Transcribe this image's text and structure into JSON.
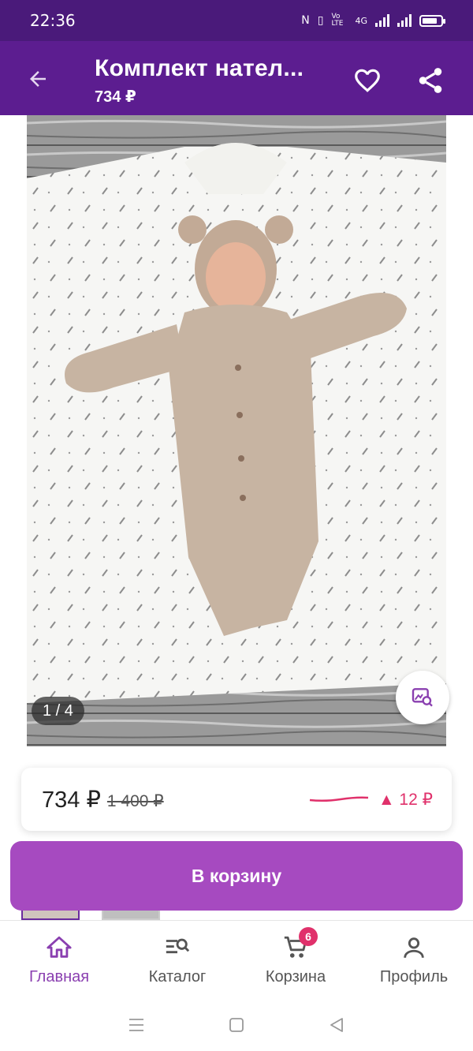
{
  "status_bar": {
    "time": "22:36",
    "network": "4G",
    "volte": "Vo LTE"
  },
  "header": {
    "title": "Комплект нател...",
    "price": "734 ₽",
    "back_icon": "arrow-back-icon",
    "favorite_icon": "heart-outline-icon",
    "share_icon": "share-icon",
    "background_color": "#5c1d90"
  },
  "gallery": {
    "indicator": "1 / 4",
    "current_index": 1,
    "total": 4,
    "zoom_icon": "image-search-icon"
  },
  "price_card": {
    "current_price": "734 ₽",
    "old_price": "1 400 ₽",
    "change": "▲ 12 ₽",
    "change_color": "#e0316b"
  },
  "cart_button": {
    "label": "В корзину",
    "color": "#a64ac0"
  },
  "bottom_nav": {
    "items": [
      {
        "label": "Главная",
        "icon": "home-icon",
        "active": true
      },
      {
        "label": "Каталог",
        "icon": "catalog-search-icon",
        "active": false
      },
      {
        "label": "Корзина",
        "icon": "cart-icon",
        "active": false,
        "badge": "6"
      },
      {
        "label": "Профиль",
        "icon": "profile-icon",
        "active": false
      }
    ],
    "active_color": "#8a3fb0"
  },
  "system_nav": {
    "menu_icon": "menu-lines-icon",
    "home_icon": "square-home-icon",
    "back_icon": "triangle-back-icon"
  }
}
